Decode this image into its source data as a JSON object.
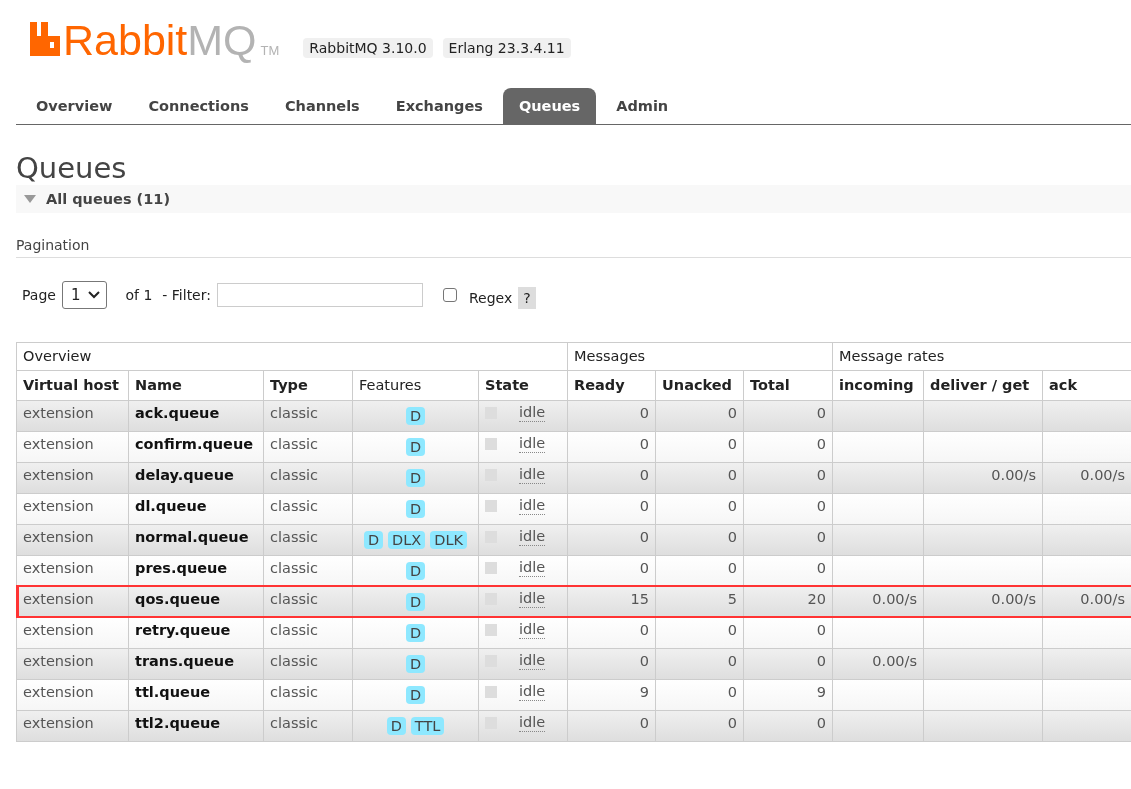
{
  "logo": {
    "brand": "Rabbit",
    "suffix": "MQ",
    "mark": "TM"
  },
  "versions": [
    "RabbitMQ 3.10.0",
    "Erlang 23.3.4.11"
  ],
  "tabs": [
    {
      "label": "Overview",
      "selected": false
    },
    {
      "label": "Connections",
      "selected": false
    },
    {
      "label": "Channels",
      "selected": false
    },
    {
      "label": "Exchanges",
      "selected": false
    },
    {
      "label": "Queues",
      "selected": true
    },
    {
      "label": "Admin",
      "selected": false
    }
  ],
  "page_title": "Queues",
  "section": {
    "title": "All queues (11)",
    "expanded": true
  },
  "pagination": {
    "heading": "Pagination",
    "page_label": "Page",
    "page": "1",
    "of_label": "of",
    "pages": "1",
    "filter_label": "- Filter:",
    "regex_label": "Regex",
    "regex_checked": false,
    "help": "?"
  },
  "table": {
    "groups": [
      {
        "label": "Overview"
      },
      {
        "label": "Messages"
      },
      {
        "label": "Message rates"
      }
    ],
    "columns": [
      {
        "label": "Virtual host",
        "bold": true
      },
      {
        "label": "Name",
        "bold": true
      },
      {
        "label": "Type",
        "bold": true
      },
      {
        "label": "Features",
        "bold": false
      },
      {
        "label": "State",
        "bold": true
      },
      {
        "label": "Ready",
        "bold": true
      },
      {
        "label": "Unacked",
        "bold": true
      },
      {
        "label": "Total",
        "bold": true
      },
      {
        "label": "incoming",
        "bold": true
      },
      {
        "label": "deliver / get",
        "bold": true
      },
      {
        "label": "ack",
        "bold": true
      }
    ],
    "rows": [
      {
        "vhost": "extension",
        "name": "ack.queue",
        "type": "classic",
        "features": [
          "D"
        ],
        "state": "idle",
        "ready": "0",
        "unacked": "0",
        "total": "0",
        "highlighted": false
      },
      {
        "vhost": "extension",
        "name": "confirm.queue",
        "type": "classic",
        "features": [
          "D"
        ],
        "state": "idle",
        "ready": "0",
        "unacked": "0",
        "total": "0",
        "highlighted": false
      },
      {
        "vhost": "extension",
        "name": "delay.queue",
        "type": "classic",
        "features": [
          "D"
        ],
        "state": "idle",
        "ready": "0",
        "unacked": "0",
        "total": "0",
        "deliver": "0.00/s",
        "ack": "0.00/s",
        "highlighted": false
      },
      {
        "vhost": "extension",
        "name": "dl.queue",
        "type": "classic",
        "features": [
          "D"
        ],
        "state": "idle",
        "ready": "0",
        "unacked": "0",
        "total": "0",
        "highlighted": false
      },
      {
        "vhost": "extension",
        "name": "normal.queue",
        "type": "classic",
        "features": [
          "D",
          "DLX",
          "DLK"
        ],
        "state": "idle",
        "ready": "0",
        "unacked": "0",
        "total": "0",
        "highlighted": false
      },
      {
        "vhost": "extension",
        "name": "pres.queue",
        "type": "classic",
        "features": [
          "D"
        ],
        "state": "idle",
        "ready": "0",
        "unacked": "0",
        "total": "0",
        "highlighted": false
      },
      {
        "vhost": "extension",
        "name": "qos.queue",
        "type": "classic",
        "features": [
          "D"
        ],
        "state": "idle",
        "ready": "15",
        "unacked": "5",
        "total": "20",
        "incoming": "0.00/s",
        "deliver": "0.00/s",
        "ack": "0.00/s",
        "highlighted": true
      },
      {
        "vhost": "extension",
        "name": "retry.queue",
        "type": "classic",
        "features": [
          "D"
        ],
        "state": "idle",
        "ready": "0",
        "unacked": "0",
        "total": "0",
        "highlighted": false
      },
      {
        "vhost": "extension",
        "name": "trans.queue",
        "type": "classic",
        "features": [
          "D"
        ],
        "state": "idle",
        "ready": "0",
        "unacked": "0",
        "total": "0",
        "incoming": "0.00/s",
        "highlighted": false
      },
      {
        "vhost": "extension",
        "name": "ttl.queue",
        "type": "classic",
        "features": [
          "D"
        ],
        "state": "idle",
        "ready": "9",
        "unacked": "0",
        "total": "9",
        "highlighted": false
      },
      {
        "vhost": "extension",
        "name": "ttl2.queue",
        "type": "classic",
        "features": [
          "D",
          "TTL"
        ],
        "state": "idle",
        "ready": "0",
        "unacked": "0",
        "total": "0",
        "highlighted": false
      }
    ]
  }
}
